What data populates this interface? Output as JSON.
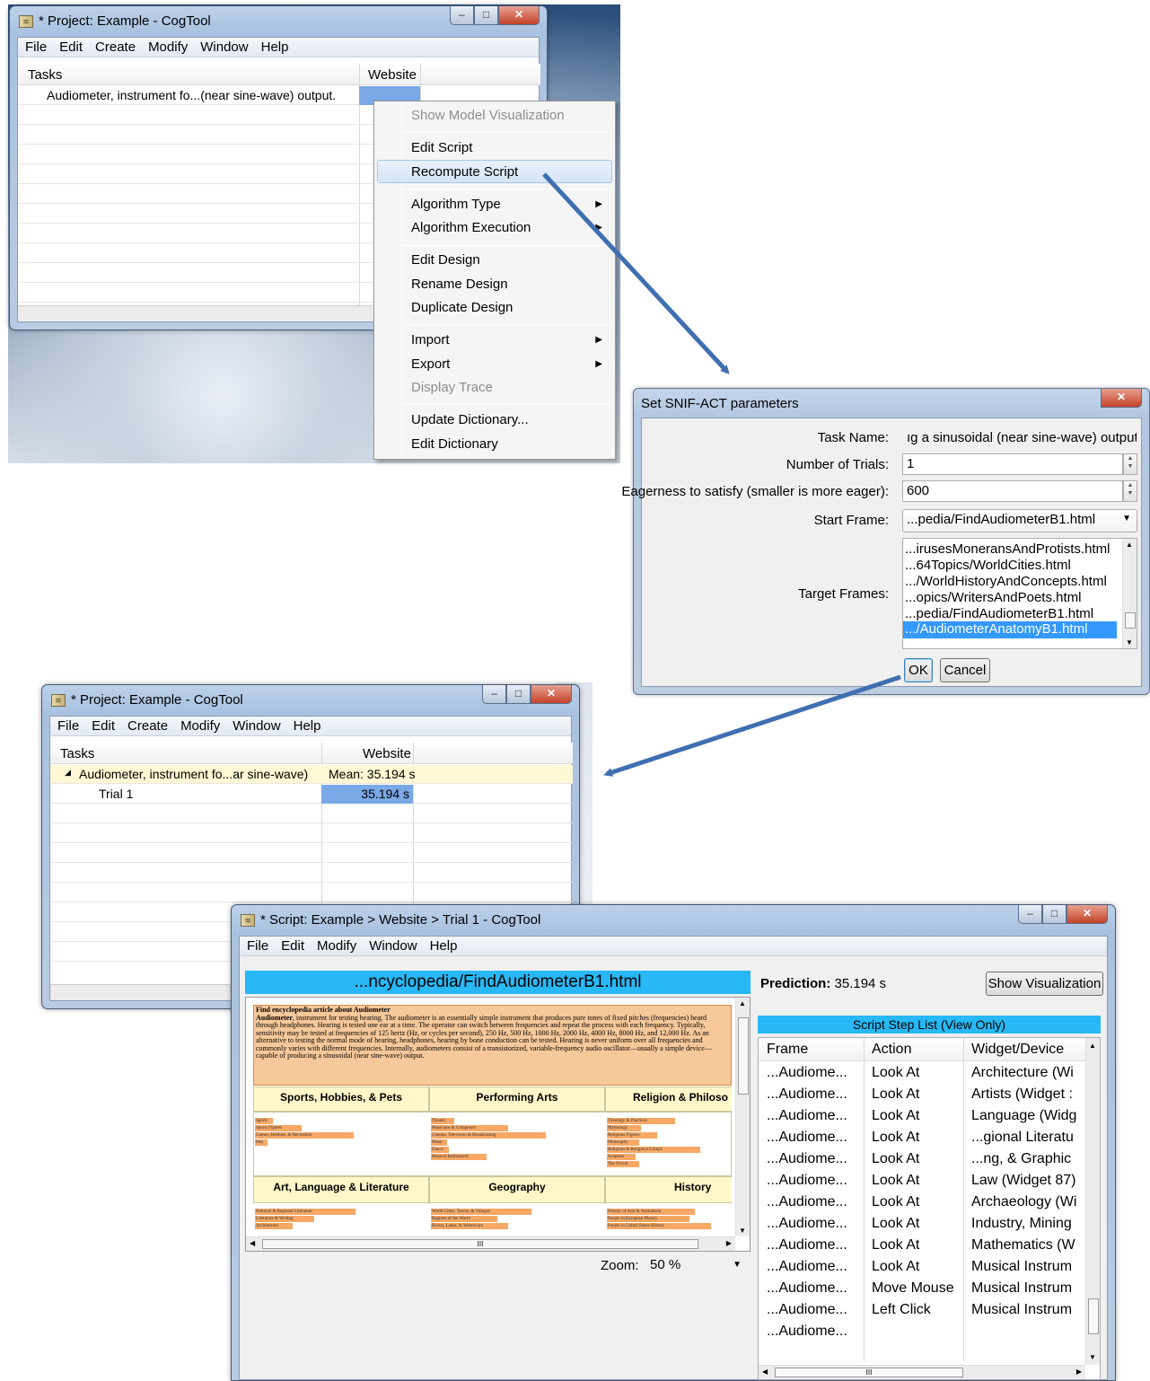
{
  "project_window_top": {
    "title": "* Project: Example - CogTool",
    "menu": [
      "File",
      "Edit",
      "Create",
      "Modify",
      "Window",
      "Help"
    ],
    "columns": {
      "tasks": "Tasks",
      "website": "Website"
    },
    "task_row": "Audiometer, instrument fo...(near sine-wave) output."
  },
  "context_menu": {
    "items": [
      {
        "label": "Show Model Visualization",
        "disabled": true
      },
      {
        "label": "Edit Script"
      },
      {
        "label": "Recompute Script",
        "highlighted": true
      },
      {
        "label": "Algorithm Type",
        "submenu": true
      },
      {
        "label": "Algorithm Execution",
        "submenu": true
      },
      {
        "label": "Edit Design"
      },
      {
        "label": "Rename Design"
      },
      {
        "label": "Duplicate Design"
      },
      {
        "label": "Import",
        "submenu": true
      },
      {
        "label": "Export",
        "submenu": true
      },
      {
        "label": "Display Trace",
        "disabled": true
      },
      {
        "label": "Update Dictionary..."
      },
      {
        "label": "Edit Dictionary"
      }
    ]
  },
  "snif_dialog": {
    "title": "Set SNIF-ACT parameters",
    "task_name_label": "Task Name:",
    "task_name_value": "ıg a sinusoidal (near sine-wave) output.",
    "trials_label": "Number of Trials:",
    "trials_value": "1",
    "eagerness_label": "Eagerness to satisfy (smaller is more eager):",
    "eagerness_value": "600",
    "start_frame_label": "Start Frame:",
    "start_frame_value": "...pedia/FindAudiometerB1.html",
    "target_frames_label": "Target Frames:",
    "target_frames": [
      "...irusesMoneransAndProtists.html",
      "...64Topics/WorldCities.html",
      ".../WorldHistoryAndConcepts.html",
      "...opics/WritersAndPoets.html",
      "...pedia/FindAudiometerB1.html",
      ".../AudiometerAnatomyB1.html"
    ],
    "ok": "OK",
    "cancel": "Cancel"
  },
  "project_window_bottom": {
    "title": "* Project: Example - CogTool",
    "menu": [
      "File",
      "Edit",
      "Create",
      "Modify",
      "Window",
      "Help"
    ],
    "columns": {
      "tasks": "Tasks",
      "website": "Website"
    },
    "task_row": "Audiometer, instrument fo...ar sine-wave)",
    "task_mean": "Mean: 35.194 s",
    "trial_label": "Trial 1",
    "trial_value": "35.194 s"
  },
  "script_window": {
    "title": "* Script: Example > Website > Trial 1 - CogTool",
    "menu": [
      "File",
      "Edit",
      "Modify",
      "Window",
      "Help"
    ],
    "frame_title": "...ncyclopedia/FindAudiometerB1.html",
    "prediction_label": "Prediction:",
    "prediction_value": "35.194 s",
    "show_visualization": "Show Visualization",
    "step_list_title": "Script Step List (View Only)",
    "zoom_label": "Zoom:",
    "zoom_value": "50 %",
    "step_columns": {
      "frame": "Frame",
      "action": "Action",
      "widget": "Widget/Device"
    },
    "steps": [
      {
        "frame": "...Audiome...",
        "action": "Look At",
        "widget": "Architecture (Wi"
      },
      {
        "frame": "...Audiome...",
        "action": "Look At",
        "widget": "Artists (Widget :"
      },
      {
        "frame": "...Audiome...",
        "action": "Look At",
        "widget": "Language (Widg"
      },
      {
        "frame": "...Audiome...",
        "action": "Look At",
        "widget": "...gional Literatu"
      },
      {
        "frame": "...Audiome...",
        "action": "Look At",
        "widget": "...ng, & Graphic"
      },
      {
        "frame": "...Audiome...",
        "action": "Look At",
        "widget": "Law (Widget 87)"
      },
      {
        "frame": "...Audiome...",
        "action": "Look At",
        "widget": "Archaeology (Wi"
      },
      {
        "frame": "...Audiome...",
        "action": "Look At",
        "widget": "Industry, Mining"
      },
      {
        "frame": "...Audiome...",
        "action": "Look At",
        "widget": "Mathematics (W"
      },
      {
        "frame": "...Audiome...",
        "action": "Look At",
        "widget": "Musical Instrum"
      },
      {
        "frame": "...Audiome...",
        "action": "Move Mouse",
        "widget": "Musical Instrum"
      },
      {
        "frame": "...Audiome...",
        "action": "Left Click",
        "widget": "Musical Instrum"
      },
      {
        "frame": "...Audiome...",
        "action": "",
        "widget": ""
      }
    ],
    "webpage": {
      "heading": "Find encyclopedia article about Audiometer",
      "body_bold": "Audiometer",
      "body": ", instrument for testing hearing. The audiometer is an essentially simple instrument that produces pure tones of fixed pitches (frequencies) heard through headphones. Hearing is tested one ear at a time. The operator can switch between frequencies and repeat the process with each frequency. Typically, sensitivity may be tested at frequencies of 125 hertz (Hz, or cycles per second), 250 Hz, 500 Hz, 1000 Hz, 2000 Hz, 4000 Hz, 8000 Hz, and 12,000 Hz. As an alternative to testing the normal mode of hearing, headphones, hearing by bone conduction can be tested. Hearing is never uniform over all frequencies and commonly varies with different frequencies. Internally, audiometers consist of a transistorized, variable-frequency audio oscillator—usually a simple device—capable of producing a sinusoidal (near sine-wave) output.",
      "categories": [
        {
          "title": "Sports, Hobbies, & Pets",
          "links": [
            "Sports",
            "Sports Figures",
            "Games, Hobbies, & Recreation",
            "Pets"
          ]
        },
        {
          "title": "Performing Arts",
          "links": [
            "Theater",
            "Musicians & Composers",
            "Cinema, Television & Broadcasting",
            "Music",
            "Dance",
            "Musical Instruments"
          ]
        },
        {
          "title": "Religion & Philoso",
          "links": [
            "Theology & Practices",
            "Mythology",
            "Religious Figures",
            "Philosophy",
            "Religions & Religious Groups",
            "Scripture",
            "The Occult"
          ]
        },
        {
          "title": "Art, Language & Literature",
          "links": [
            "National & Regional Literature",
            "Literature & Writing",
            "Architecture"
          ]
        },
        {
          "title": "Geography",
          "links": [
            "World Cities, Towns, & Villages",
            "Regions of the World",
            "Rivers, Lakes, & Waterways"
          ]
        },
        {
          "title": "History",
          "links": [
            "History of Asia & Australasia",
            "People in European History",
            "People in United States History"
          ]
        }
      ]
    },
    "hscroll_grip": "III"
  }
}
